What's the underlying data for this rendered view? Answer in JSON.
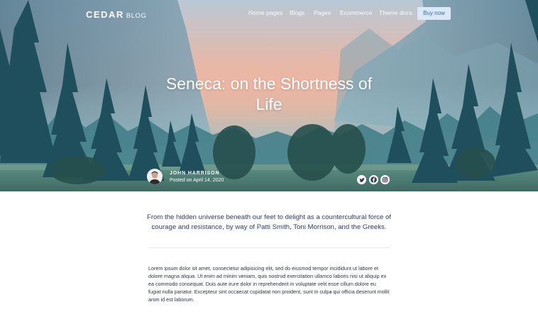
{
  "brand": {
    "name": "CEDAR",
    "suffix": "BLOG"
  },
  "nav": {
    "items": [
      {
        "label": "Home pages"
      },
      {
        "label": "Blogs"
      },
      {
        "label": "Pages"
      },
      {
        "label": "Ecommerce"
      },
      {
        "label": "Theme docs"
      }
    ],
    "cta_label": "Buy now"
  },
  "post": {
    "title": "Seneca: on the Shortness of Life",
    "author_name": "JOHN HARRISON",
    "posted": "Posted on April 14, 2020",
    "lead": "From the hidden universe beneath our feet to delight as a countercultural force of courage and resistance, by way of Patti Smith, Toni Morrison, and the Greeks.",
    "body": "Lorem ipsum dolor sit amet, consectetur adipisicing elit, sed do eiusmod tempor incididunt ut labore et dolore magna aliqua. Ut enim ad minim veniam, quis nostrud exercitation ullamco laboris nisi ut aliquip ex ea commodo consequat. Duis aute irure dolor in reprehenderit in voluptate velit esse cillum dolore eu fugiat nulla pariatur. Excepteur sint occaecat cupidatat non proident, sunt in culpa qui officia deserunt mollit anim id est laborum."
  },
  "social_icons": [
    "twitter-icon",
    "facebook-icon",
    "instagram-icon"
  ],
  "colors": {
    "accent": "#2f6fb2",
    "button_bg": "#dce8f6",
    "lead_text": "#2f3d6b",
    "sky_peach": "#f3b49a",
    "forest": "#2f6f7f"
  }
}
